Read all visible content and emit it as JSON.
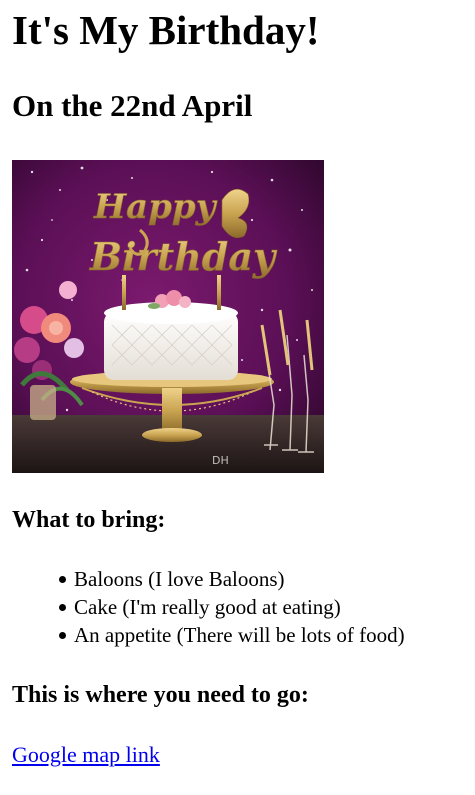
{
  "page": {
    "title": "It's My Birthday!",
    "date_heading": "On the 22nd April"
  },
  "photo": {
    "topper_line1": "Happy",
    "topper_line2": "Birthday",
    "watermark": "DH",
    "colors": {
      "background": "#5a0f55",
      "gold": "#c9a451",
      "cake": "#f4f0ea"
    }
  },
  "bring": {
    "heading": "What to bring:",
    "items": [
      "Baloons (I love Baloons)",
      "Cake (I'm really good at eating)",
      "An appetite (There will be lots of food)"
    ]
  },
  "directions": {
    "heading": "This is where you need to go:",
    "link_text": "Google map link"
  },
  "colors": {
    "link": "#0000ee",
    "text": "#000000"
  }
}
